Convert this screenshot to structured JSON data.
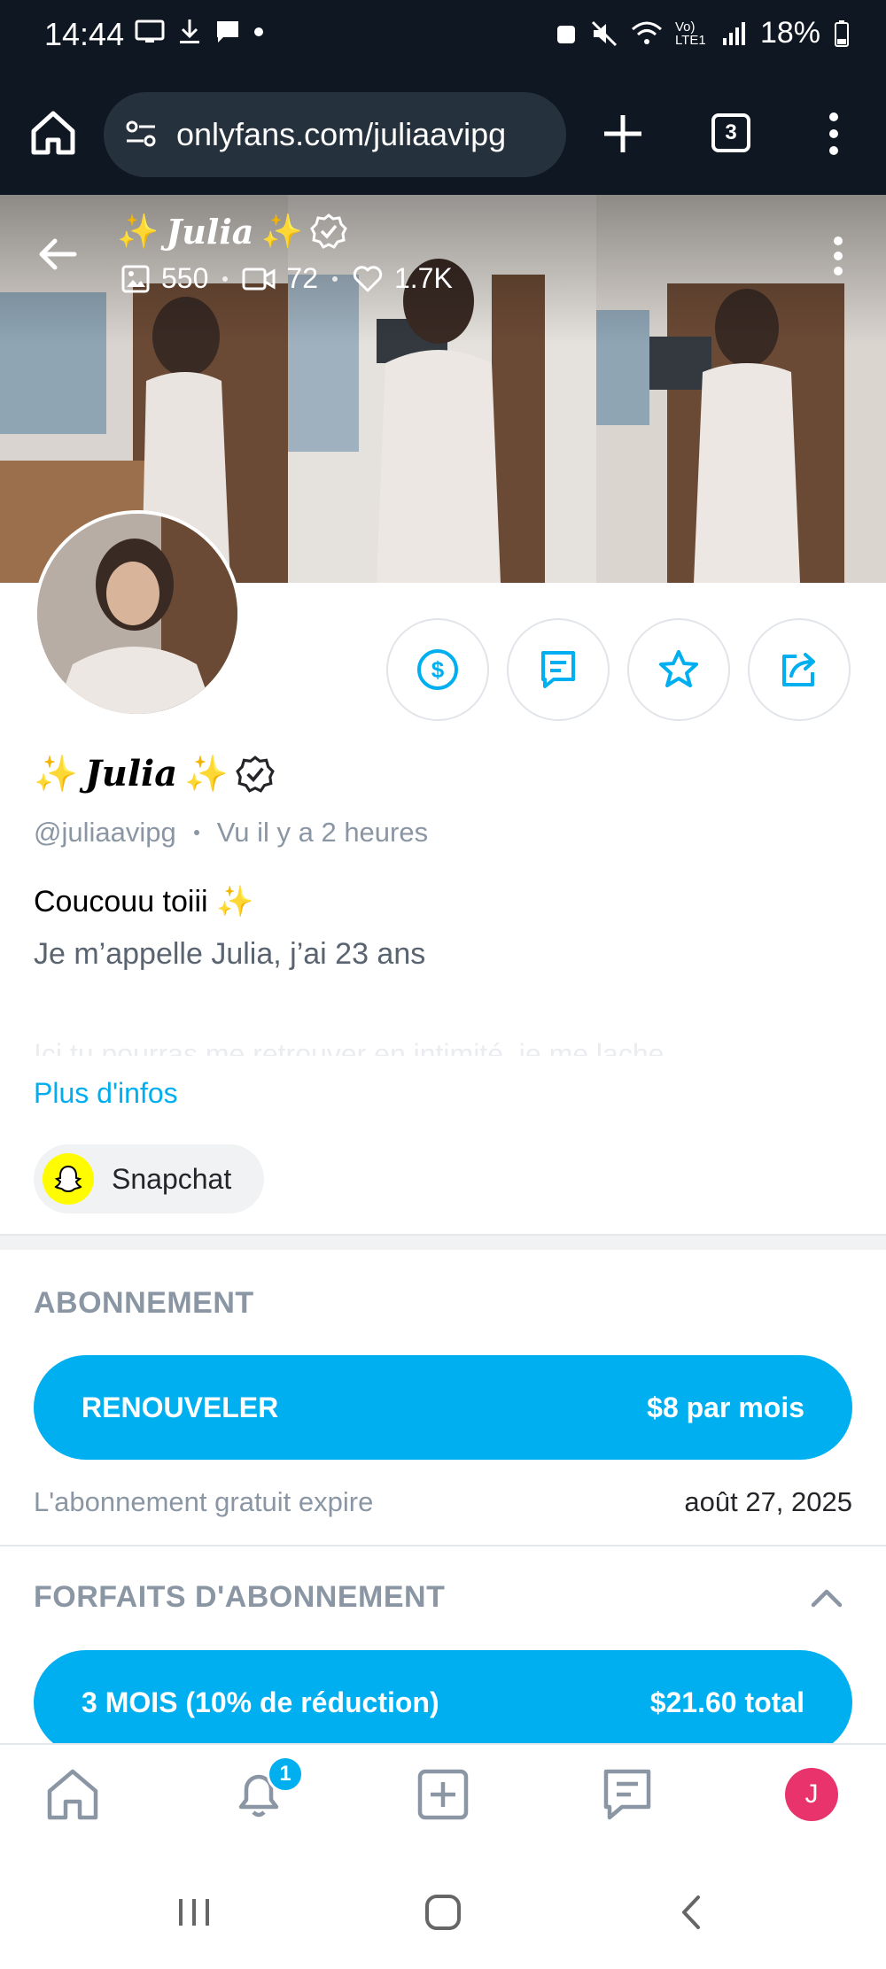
{
  "status_bar": {
    "time": "14:44",
    "battery": "18%",
    "network": "Vo) LTE1"
  },
  "browser": {
    "url": "onlyfans.com/juliaavipg",
    "tab_count": "3"
  },
  "cover": {
    "name": "Julia",
    "sparkle": "✨",
    "photos_count": "550",
    "videos_count": "72",
    "likes_count": "1.7K"
  },
  "profile": {
    "name": "Julia",
    "handle": "@juliaavipg",
    "last_seen": "Vu  il y a 2 heures",
    "bio_line1": "Coucouu toiii ✨",
    "bio_line2": "Je m’appelle Julia, j’ai 23 ans",
    "bio_line3": "Ici tu pourras me retrouver en intimité, je me lache",
    "more_info": "Plus d'infos",
    "social_link": "Snapchat"
  },
  "subscription": {
    "title": "ABONNEMENT",
    "button_label": "RENOUVELER",
    "button_price": "$8 par mois",
    "expire_label": "L'abonnement gratuit expire",
    "expire_date": "août 27, 2025"
  },
  "bundles": {
    "title": "FORFAITS D'ABONNEMENT",
    "bundle1_label": "3 MOIS (10% de réduction)",
    "bundle1_price": "$21.60 total"
  },
  "bottom_nav": {
    "notifications_badge": "1",
    "avatar_initial": "J"
  },
  "colors": {
    "accent": "#00aff0",
    "muted_text": "#8a96a3",
    "avatar_bg": "#e8336c",
    "statusbar_bg": "#0f1722"
  }
}
